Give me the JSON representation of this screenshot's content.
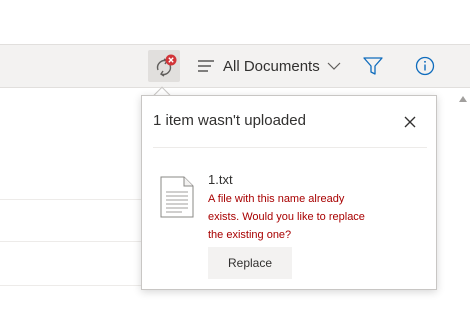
{
  "toolbar": {
    "sync_icon": "sync-error-icon",
    "view_label": "All Documents",
    "view_icon": "view-list-icon",
    "filter_icon": "filter-icon",
    "info_icon": "info-icon"
  },
  "upload_popup": {
    "title": "1 item wasn't uploaded",
    "close_icon": "close-icon",
    "file": {
      "icon": "text-file-icon",
      "name": "1.txt",
      "error_message": "A file with this name already exists. Would you like to replace the existing one?"
    },
    "replace_label": "Replace"
  },
  "colors": {
    "error_text": "#a80000",
    "error_badge": "#d13438",
    "command_bar_bg": "#f3f2f1",
    "text": "#323130"
  }
}
